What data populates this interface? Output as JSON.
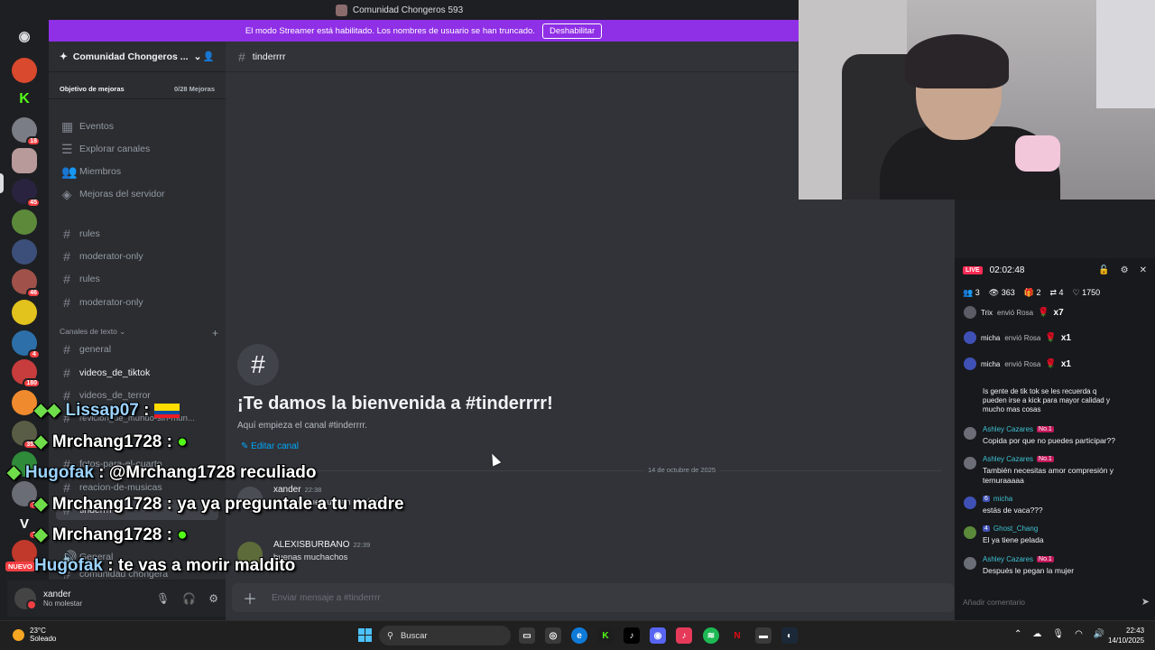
{
  "window": {
    "title": "Comunidad Chongeros 593"
  },
  "banner": {
    "text": "El modo Streamer está habilitado. Los nombres de usuario se han truncado.",
    "button": "Deshabilitar"
  },
  "rail": {
    "badges": [
      "18",
      "45",
      "46",
      "4",
      "180",
      "356",
      "2",
      "1"
    ],
    "nuevo": "NUEVO"
  },
  "sidebar": {
    "server_name": "Comunidad Chongeros ...",
    "boost_label": "Objetivo de mejoras",
    "boost_value": "0/28 Mejoras",
    "top_items": [
      "Eventos",
      "Explorar canales",
      "Miembros",
      "Mejoras del servidor"
    ],
    "pinned_channels": [
      "rules",
      "moderator-only",
      "rules",
      "moderator-only"
    ],
    "category": "Canales de texto",
    "text_channels": [
      "general",
      "videos_de_tiktok",
      "videos_de_terror",
      "revicion_de_mundo-sin-mun...",
      "fotos-para-el-cuarto",
      "reacion-de-musicas",
      "tinderrrr",
      "General",
      "comunidad chongera"
    ]
  },
  "user": {
    "name": "xander",
    "status": "No molestar"
  },
  "chat": {
    "channel": "tinderrrr",
    "welcome_title": "¡Te damos la bienvenida a #tinderrrr!",
    "welcome_sub": "Aquí empieza el canal #tinderrrr.",
    "edit_link": "Editar canal",
    "date_divider": "14 de octubre de 2025",
    "messages": [
      {
        "author": "xander",
        "time": "22:38",
        "text": "aqui los que quieran participar"
      },
      {
        "author": "ALEXISBURBANO",
        "time": "22:39",
        "text": "buenas muchachos"
      }
    ],
    "composer_placeholder": "Enviar mensaje a #tinderrrr"
  },
  "overlay_chat": [
    {
      "user": "Lissap07",
      "text": ""
    },
    {
      "user": "Mrchang1728",
      "text": ""
    },
    {
      "user": "Hugofak",
      "text": "@Mrchang1728 reculiado"
    },
    {
      "user": "Mrchang1728",
      "text": "ya ya preguntale a tu madre"
    },
    {
      "user": "Mrchang1728",
      "text": ""
    },
    {
      "user": "Hugofak",
      "text": "te vas a morir maldito"
    }
  ],
  "live": {
    "badge": "LIVE",
    "timer": "02:02:48",
    "stats": {
      "users": "3",
      "views": "363",
      "gifts": "2",
      "shares": "4",
      "likes": "1750"
    },
    "gifts": [
      {
        "who": "Trix",
        "action": "envió Rosa",
        "count": "x7"
      },
      {
        "who": "micha",
        "action": "envió Rosa",
        "count": "x1"
      },
      {
        "who": "micha",
        "action": "envió Rosa",
        "count": "x1"
      }
    ],
    "comments": [
      {
        "name": "",
        "tag": "",
        "text1": "Is gente de tik tok se les recuerda q",
        "text2": "pueden irse a kick para mayor calidad y",
        "text3": "mucho mas cosas"
      },
      {
        "name": "Ashley Cazares",
        "tag": "No.1",
        "text1": "Copida por que no puedes participar??"
      },
      {
        "name": "Ashley Cazares",
        "tag": "No.1",
        "text1": "También necesitas amor compresión y",
        "text2": "ternuraaaaa"
      },
      {
        "name": "micha",
        "tag": "6",
        "text1": "estás de vaca???"
      },
      {
        "name": "Ghost_Chang",
        "tag": "4",
        "text1": "El ya tiene pelada"
      },
      {
        "name": "Ashley Cazares",
        "tag": "No.1",
        "text1": "Después le pegan la mujer"
      }
    ],
    "input_placeholder": "Añadir comentario"
  },
  "taskbar": {
    "weather_temp": "23°C",
    "weather_desc": "Soleado",
    "search": "Buscar",
    "time": "22:43",
    "date": "14/10/2025"
  }
}
